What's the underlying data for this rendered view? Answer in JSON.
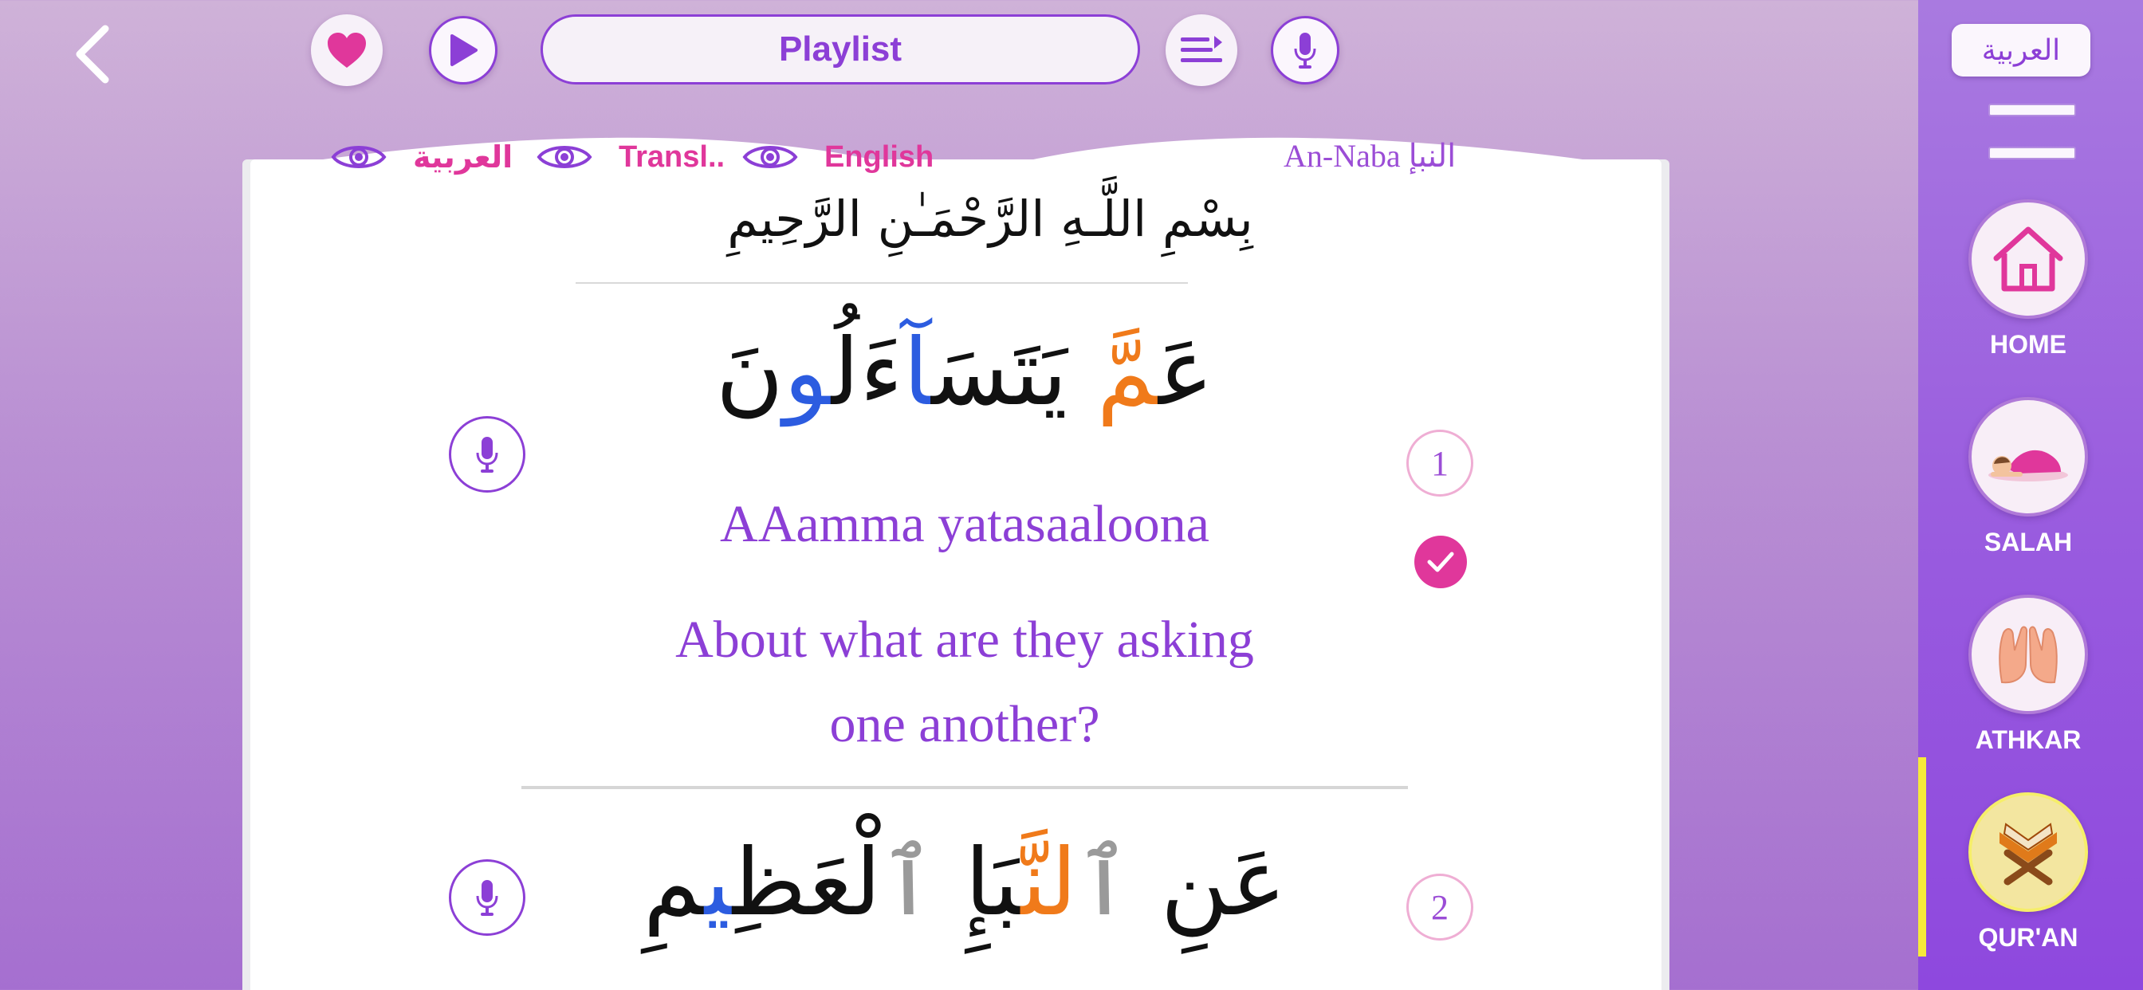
{
  "colors": {
    "accent_purple": "#8c3fd6",
    "accent_pink": "#e0379b",
    "arabic_orange": "#f07a1a",
    "arabic_blue": "#2c5ce0",
    "arabic_grey": "#9a9a9a",
    "active_indicator": "#f6ea3a"
  },
  "toolbar": {
    "back_icon": "chevron-left-icon",
    "favorite_icon": "heart-icon",
    "play_icon": "play-icon",
    "playlist_label": "Playlist",
    "queue_icon": "playlist-queue-icon",
    "mic_icon": "microphone-icon"
  },
  "page": {
    "toggles": [
      {
        "label": "العربية",
        "icon": "eye-icon"
      },
      {
        "label": "Transl..",
        "icon": "eye-icon"
      },
      {
        "label": "English",
        "icon": "eye-icon"
      }
    ],
    "surah_name": "An-Naba النبإ",
    "bismillah": "بِسْمِ اللَّـهِ الرَّحْمَـٰنِ الرَّحِيمِ"
  },
  "verses": [
    {
      "number": "1",
      "arabic_parts": [
        "عَ",
        "مَّ",
        " يَتَسَ",
        "آ",
        "ءَلُ",
        "و",
        "نَ"
      ],
      "transliteration": "AAamma yatasaaloona",
      "translation_line1": "About what are they asking",
      "translation_line2": "one another?",
      "completed": true
    },
    {
      "number": "2",
      "arabic_parts": [
        "عَنِ ",
        "ٱ",
        "لنَّ",
        "بَإِ ",
        "ٱ",
        "لْعَظِ",
        "ي",
        "مِ"
      ]
    }
  ],
  "sidebar": {
    "language_button": "العربية",
    "menu_icon": "hamburger-icon",
    "items": [
      {
        "label": "HOME",
        "icon": "home-icon"
      },
      {
        "label": "SALAH",
        "icon": "prayer-icon"
      },
      {
        "label": "ATHKAR",
        "icon": "dua-hands-icon"
      },
      {
        "label": "QUR'AN",
        "icon": "quran-stand-icon",
        "active": true
      }
    ]
  }
}
